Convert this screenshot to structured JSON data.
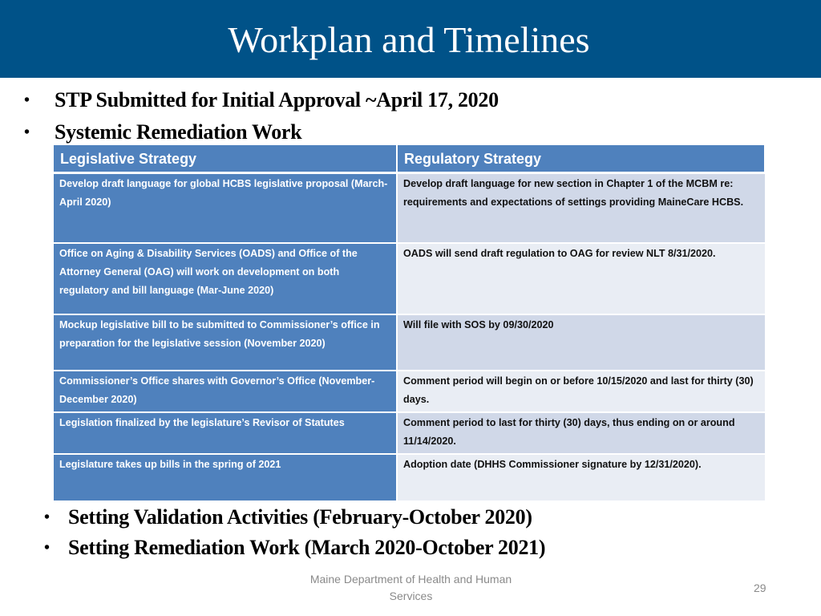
{
  "slide": {
    "title": "Workplan and Timelines",
    "bullets_top": [
      {
        "icon": "bullet-dot-icon",
        "glyph": "•",
        "text": "STP Submitted for Initial Approval ~April 17, 2020"
      },
      {
        "icon": "bullet-dot-icon",
        "glyph": "•",
        "text": "Systemic Remediation Work"
      }
    ],
    "table": {
      "headers": [
        "Legislative Strategy",
        "Regulatory Strategy"
      ],
      "rows": [
        {
          "legislative": "Develop draft language for global HCBS legislative proposal (March-April 2020)",
          "regulatory": "Develop draft language for new section in Chapter 1 of the MCBM re: requirements and expectations of settings providing MaineCare HCBS."
        },
        {
          "legislative": "Office on Aging & Disability Services (OADS) and Office of the Attorney General (OAG) will work on development on both regulatory and bill language (Mar-June 2020)",
          "regulatory": "OADS will send draft regulation to OAG for review NLT 8/31/2020."
        },
        {
          "legislative": "Mockup legislative bill to be submitted to Commissioner’s office in preparation for the legislative session (November 2020)",
          "regulatory": "Will file with SOS by 09/30/2020"
        },
        {
          "legislative": "Commissioner’s Office shares with Governor’s Office (November-December 2020)",
          "regulatory": "Comment period will begin on or before 10/15/2020 and last for thirty (30) days."
        },
        {
          "legislative": "Legislation finalized by the legislature’s Revisor of Statutes",
          "regulatory": "Comment period to last for thirty (30) days, thus ending on or around 11/14/2020."
        },
        {
          "legislative": "Legislature takes up bills in the spring of 2021",
          "regulatory": "Adoption date (DHHS Commissioner signature by 12/31/2020)."
        }
      ]
    },
    "bullets_bottom": [
      {
        "icon": "bullet-dot-icon",
        "glyph": "•",
        "text": "Setting Validation Activities (February-October 2020)"
      },
      {
        "icon": "bullet-dot-icon",
        "glyph": "•",
        "text": "Setting Remediation Work (March 2020-October 2021)"
      }
    ],
    "footer": "Maine Department of Health and Human Services",
    "page_number": "29"
  },
  "colors": {
    "title_bar": "#005288",
    "table_header": "#4f81bd",
    "legislative_cell": "#4f81bd",
    "regulatory_odd": "#d0d8e8",
    "regulatory_even": "#e9edf4"
  }
}
